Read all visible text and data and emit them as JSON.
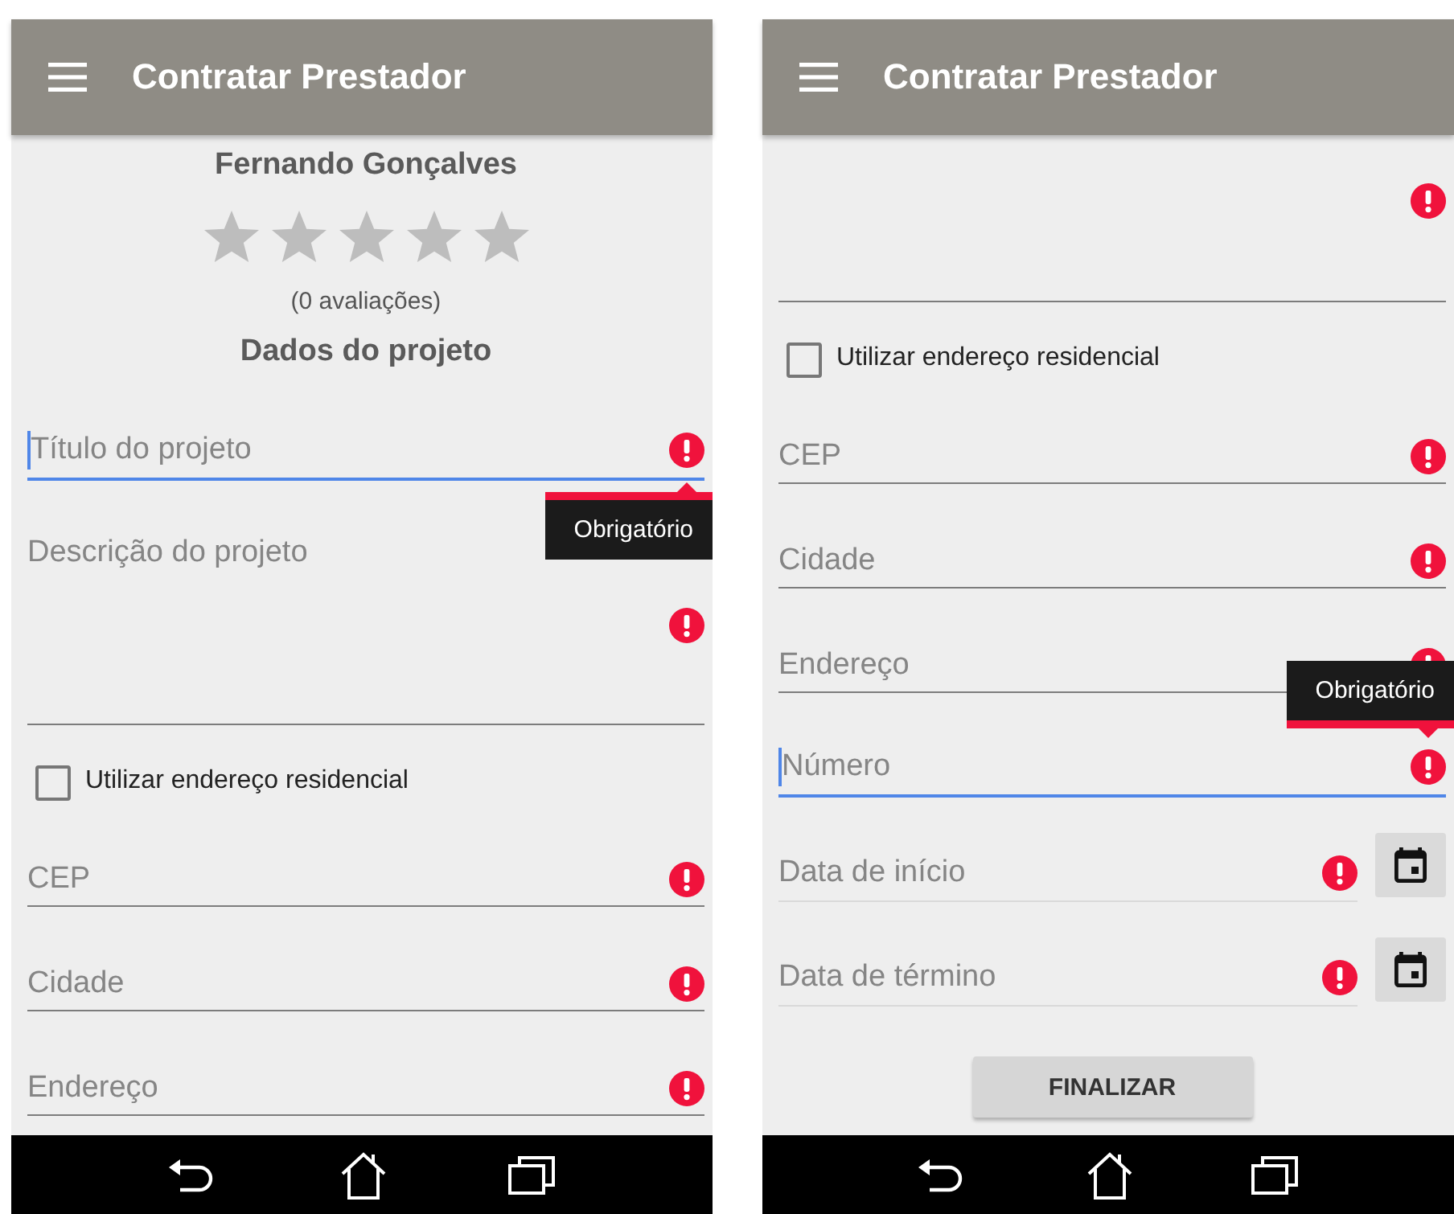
{
  "screens": [
    {
      "app_bar": {
        "title": "Contratar Prestador"
      },
      "content": [
        {
          "kind": "name",
          "text": "Fernando Gonçalves"
        },
        {
          "kind": "rating",
          "stars": 0
        },
        {
          "kind": "caption",
          "text": "(0 avaliações)"
        },
        {
          "kind": "heading",
          "text": "Dados do projeto"
        },
        {
          "kind": "field",
          "placeholder": "Título do projeto",
          "focused": true,
          "error": true,
          "tooltip": {
            "kind": "below",
            "text": "Obrigatório"
          }
        },
        {
          "kind": "multiline",
          "placeholder": "Descrição do projeto",
          "focused": false,
          "error": true
        },
        {
          "kind": "checkbox",
          "label": "Utilizar endereço residencial",
          "checked": false
        },
        {
          "kind": "field",
          "placeholder": "CEP",
          "focused": false,
          "error": true
        },
        {
          "kind": "field",
          "placeholder": "Cidade",
          "focused": false,
          "error": true
        },
        {
          "kind": "field",
          "placeholder": "Endereço",
          "focused": false,
          "error": true
        }
      ]
    },
    {
      "app_bar": {
        "title": "Contratar Prestador"
      },
      "content": [
        {
          "kind": "multiline",
          "focused": false,
          "error": true
        },
        {
          "kind": "checkbox",
          "label": "Utilizar endereço residencial",
          "checked": false
        },
        {
          "kind": "field",
          "placeholder": "CEP",
          "focused": false,
          "error": true
        },
        {
          "kind": "field",
          "placeholder": "Cidade",
          "focused": false,
          "error": true
        },
        {
          "kind": "field",
          "placeholder": "Endereço",
          "focused": false,
          "error": true
        },
        {
          "kind": "field",
          "placeholder": "Número",
          "focused": true,
          "error": true,
          "tooltip": {
            "kind": "above",
            "text": "Obrigatório"
          }
        },
        {
          "kind": "date",
          "placeholder": "Data de início",
          "error": true
        },
        {
          "kind": "date",
          "placeholder": "Data de término",
          "error": true
        },
        {
          "kind": "button",
          "label": "FINALIZAR"
        }
      ]
    }
  ]
}
